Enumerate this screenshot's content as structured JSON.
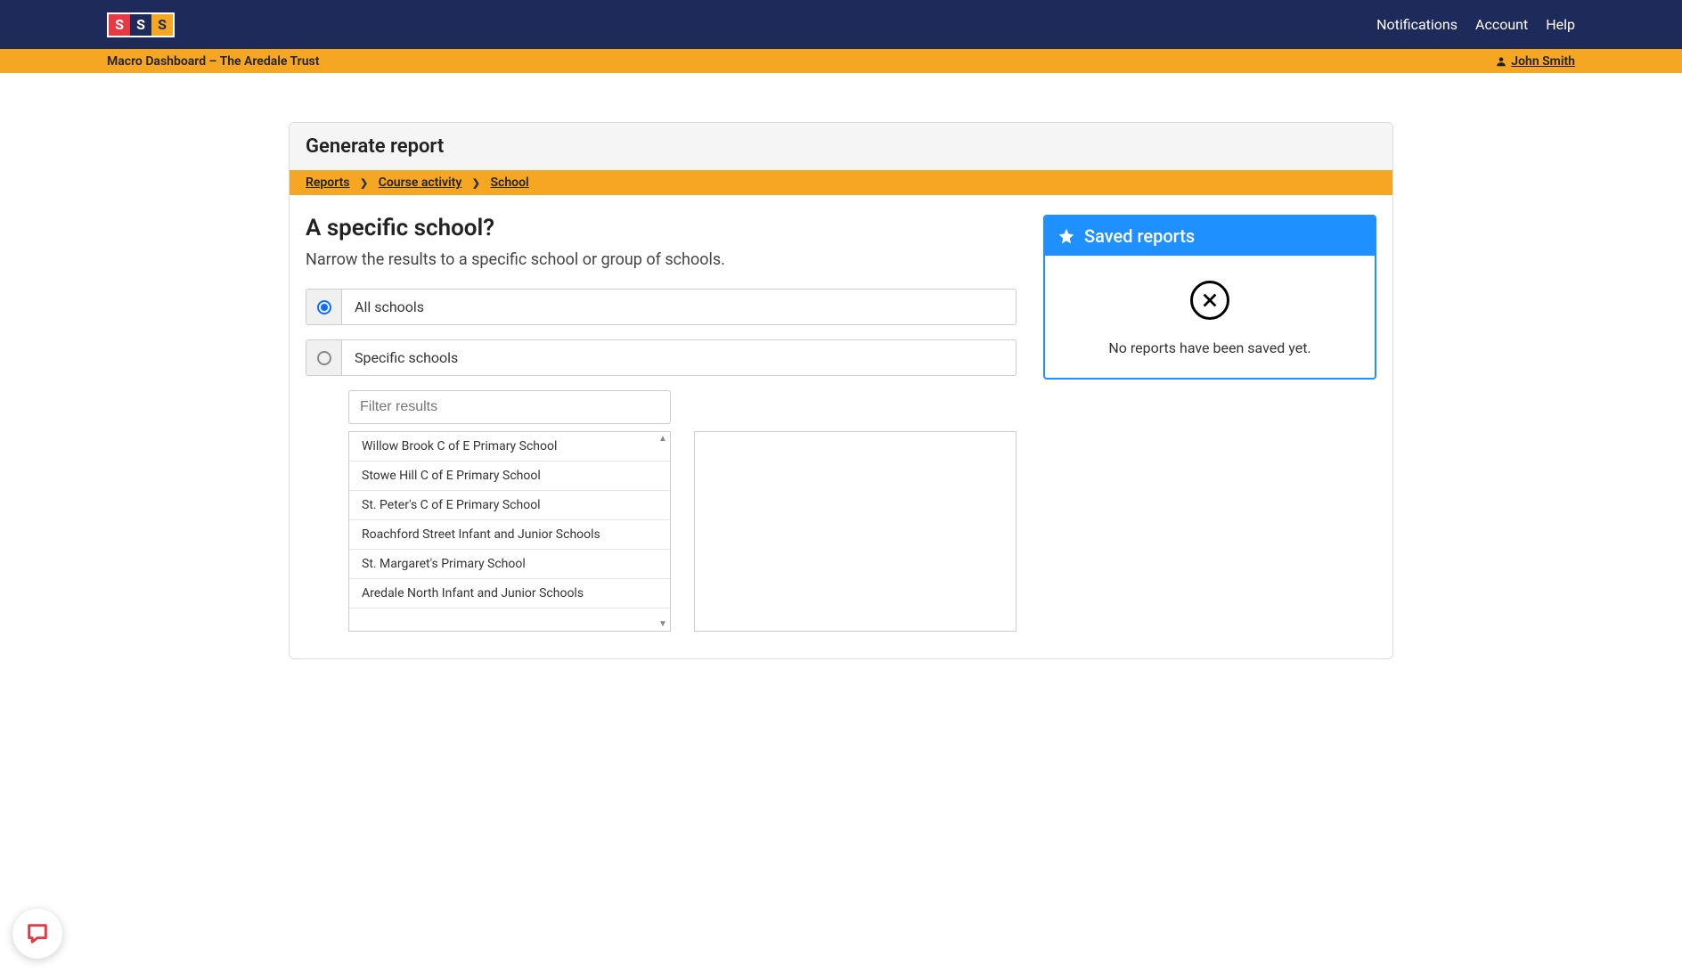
{
  "topnav": {
    "notifications": "Notifications",
    "account": "Account",
    "help": "Help"
  },
  "subbar": {
    "title": "Macro Dashboard – The Aredale Trust",
    "user": "John Smith"
  },
  "card": {
    "title": "Generate report"
  },
  "breadcrumb": {
    "reports": "Reports",
    "course_activity": "Course activity",
    "school": "School"
  },
  "main": {
    "heading": "A specific school?",
    "description": "Narrow the results to a specific school or group of schools.",
    "option_all": "All schools",
    "option_specific": "Specific schools",
    "filter_placeholder": "Filter results",
    "schools": [
      "Willow Brook C of E Primary School",
      "Stowe Hill C of E Primary School",
      "St. Peter's C of E Primary School",
      "Roachford Street Infant and Junior Schools",
      "St. Margaret's Primary School",
      "Aredale North Infant and Junior Schools"
    ]
  },
  "saved": {
    "title": "Saved reports",
    "empty": "No reports have been saved yet."
  }
}
